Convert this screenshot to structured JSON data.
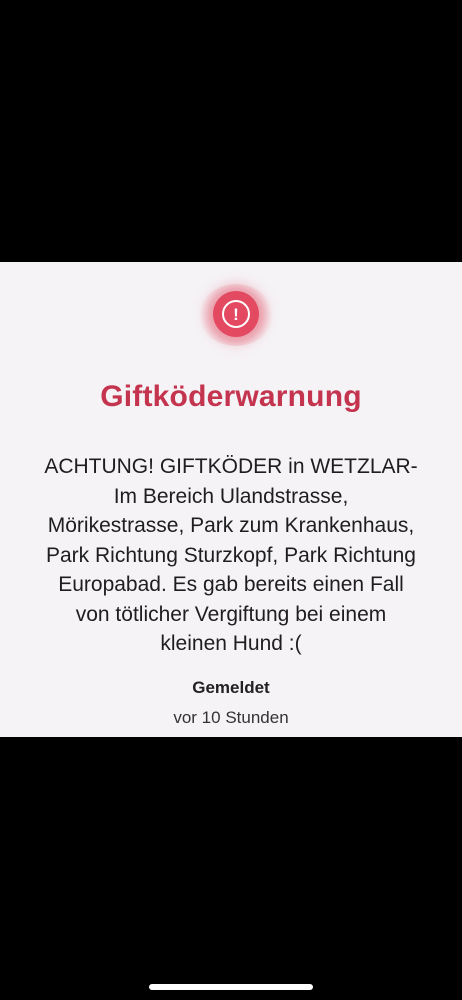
{
  "alert": {
    "icon": "exclamation-circle-icon",
    "glyph": "!",
    "accent_color": "#e34a62"
  },
  "title": "Giftköderwarnung",
  "title_color": "#c4344e",
  "message_lines": [
    "ACHTUNG! GIFTKÖDER in WETZLAR-",
    "Im Bereich Ulandstrasse,",
    "Mörikestrasse, Park zum Krankenhaus,",
    "Park Richtung Sturzkopf, Park Richtung",
    "Europabad. Es gab bereits einen Fall",
    "von tötlicher Vergiftung bei einem",
    "kleinen Hund :("
  ],
  "reported": {
    "label": "Gemeldet",
    "time": "vor 10 Stunden"
  }
}
